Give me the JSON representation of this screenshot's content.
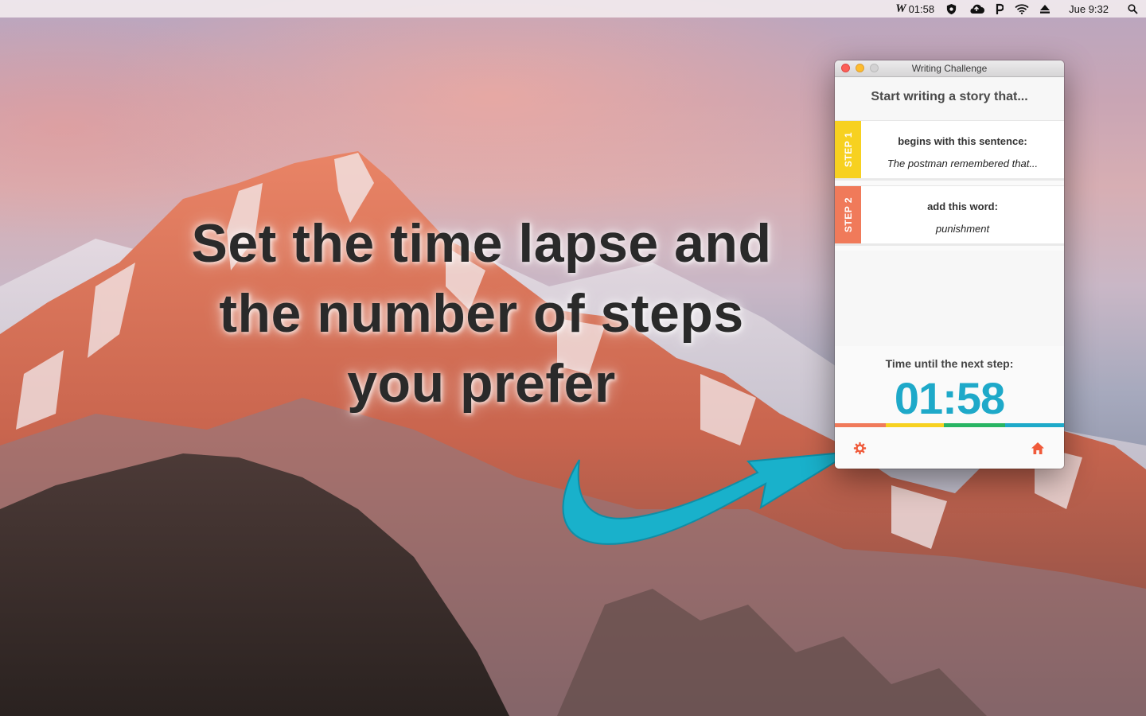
{
  "menubar": {
    "app_timer": "01:58",
    "app_timer_logo": "W",
    "icons": [
      "shield-icon",
      "cloud-icon",
      "p-icon",
      "wifi-icon",
      "eject-icon"
    ],
    "clock": "Jue 9:32",
    "search_icon": "search-icon"
  },
  "headline": {
    "line1": "Set the time lapse and",
    "line2": "the number of steps",
    "line3": "you prefer"
  },
  "window": {
    "title": "Writing Challenge",
    "intro": "Start writing a story that...",
    "steps": [
      {
        "tab": "STEP 1",
        "label": "begins with this sentence:",
        "value": "The postman remembered that...",
        "color": "#f7d120"
      },
      {
        "tab": "STEP 2",
        "label": "add this word:",
        "value": "punishment",
        "color": "#f07a5a"
      }
    ],
    "timer_label": "Time until the next step:",
    "timer_value": "01:58",
    "color_bar": [
      "#f07a5a",
      "#f7d120",
      "#28b463",
      "#1ea9c9"
    ],
    "bottom": {
      "settings_icon": "gear-icon",
      "home_icon": "home-icon"
    }
  },
  "colors": {
    "accent": "#1ea9c9",
    "icon": "#f05a3a",
    "arrow": "#19b1cb"
  }
}
